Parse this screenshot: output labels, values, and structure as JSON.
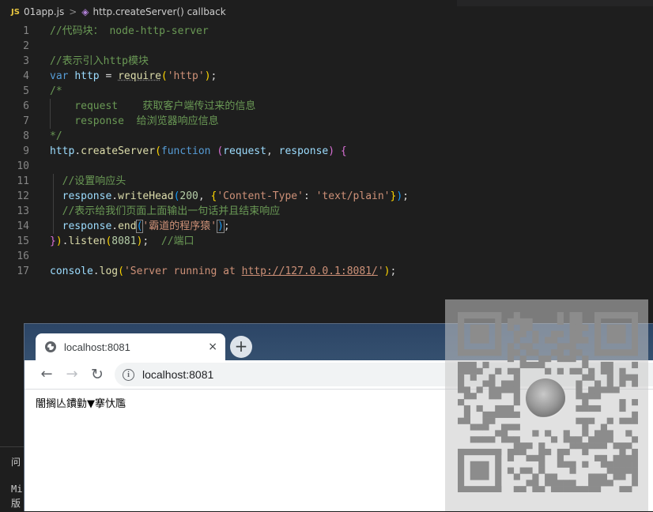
{
  "breadcrumb": {
    "file_badge": "JS",
    "file_name": "01app.js",
    "separator": ">",
    "symbol": "http.createServer() callback"
  },
  "editor": {
    "lines": [
      {
        "n": "1",
        "tokens": [
          {
            "t": "//代码块： node-http-server",
            "c": "c-comment"
          }
        ]
      },
      {
        "n": "2",
        "tokens": []
      },
      {
        "n": "3",
        "tokens": [
          {
            "t": "//表示引入http模块",
            "c": "c-comment"
          }
        ]
      },
      {
        "n": "4",
        "tokens": [
          {
            "t": "var",
            "c": "c-kw"
          },
          {
            "t": " "
          },
          {
            "t": "http",
            "c": "c-var"
          },
          {
            "t": " = "
          },
          {
            "t": "require",
            "c": "c-fn c-under"
          },
          {
            "t": "(",
            "c": "c-br1"
          },
          {
            "t": "'http'",
            "c": "c-str"
          },
          {
            "t": ")",
            "c": "c-br1"
          },
          {
            "t": ";"
          }
        ]
      },
      {
        "n": "5",
        "tokens": [
          {
            "t": "/*",
            "c": "c-comment"
          }
        ]
      },
      {
        "n": "6",
        "tokens": [
          {
            "t": "    request    获取客户端传过来的信息",
            "c": "c-comment"
          }
        ]
      },
      {
        "n": "7",
        "tokens": [
          {
            "t": "    response  给浏览器响应信息",
            "c": "c-comment"
          }
        ]
      },
      {
        "n": "8",
        "tokens": [
          {
            "t": "*/",
            "c": "c-comment"
          }
        ]
      },
      {
        "n": "9",
        "tokens": [
          {
            "t": "http",
            "c": "c-var"
          },
          {
            "t": "."
          },
          {
            "t": "createServer",
            "c": "c-fn"
          },
          {
            "t": "(",
            "c": "c-br1"
          },
          {
            "t": "function",
            "c": "c-kw"
          },
          {
            "t": " "
          },
          {
            "t": "(",
            "c": "c-br2"
          },
          {
            "t": "request",
            "c": "c-var"
          },
          {
            "t": ", "
          },
          {
            "t": "response",
            "c": "c-var"
          },
          {
            "t": ")",
            "c": "c-br2"
          },
          {
            "t": " "
          },
          {
            "t": "{",
            "c": "c-br2"
          }
        ]
      },
      {
        "n": "10",
        "tokens": []
      },
      {
        "n": "11",
        "tokens": [
          {
            "t": "  //设置响应头",
            "c": "c-comment"
          }
        ]
      },
      {
        "n": "12",
        "tokens": [
          {
            "t": "  "
          },
          {
            "t": "response",
            "c": "c-var"
          },
          {
            "t": "."
          },
          {
            "t": "writeHead",
            "c": "c-fn"
          },
          {
            "t": "(",
            "c": "c-br3"
          },
          {
            "t": "200",
            "c": "c-num"
          },
          {
            "t": ", "
          },
          {
            "t": "{",
            "c": "c-br1"
          },
          {
            "t": "'Content-Type'",
            "c": "c-str"
          },
          {
            "t": ": "
          },
          {
            "t": "'text/plain'",
            "c": "c-str"
          },
          {
            "t": "}",
            "c": "c-br1"
          },
          {
            "t": ")",
            "c": "c-br3"
          },
          {
            "t": ";"
          }
        ]
      },
      {
        "n": "13",
        "tokens": [
          {
            "t": "  //表示给我们页面上面输出一句话并且结束响应",
            "c": "c-comment"
          }
        ]
      },
      {
        "n": "14",
        "tokens": [
          {
            "t": "  "
          },
          {
            "t": "response",
            "c": "c-var"
          },
          {
            "t": "."
          },
          {
            "t": "end",
            "c": "c-fn"
          },
          {
            "t": "(",
            "c": "c-br3 hl-box"
          },
          {
            "t": "'霸道的程序猿'",
            "c": "c-str"
          },
          {
            "t": ")",
            "c": "c-br3 hl-box"
          },
          {
            "t": ";"
          }
        ]
      },
      {
        "n": "15",
        "tokens": [
          {
            "t": "}",
            "c": "c-br2"
          },
          {
            "t": ")",
            "c": "c-br1"
          },
          {
            "t": "."
          },
          {
            "t": "listen",
            "c": "c-fn"
          },
          {
            "t": "(",
            "c": "c-br1"
          },
          {
            "t": "8081",
            "c": "c-num"
          },
          {
            "t": ")",
            "c": "c-br1"
          },
          {
            "t": ";  "
          },
          {
            "t": "//端口",
            "c": "c-comment"
          }
        ]
      },
      {
        "n": "16",
        "tokens": []
      },
      {
        "n": "17",
        "tokens": [
          {
            "t": "console",
            "c": "c-var"
          },
          {
            "t": "."
          },
          {
            "t": "log",
            "c": "c-fn"
          },
          {
            "t": "(",
            "c": "c-br1"
          },
          {
            "t": "'Server running at ",
            "c": "c-str"
          },
          {
            "t": "http://127.0.0.1:8081/",
            "c": "c-str c-link"
          },
          {
            "t": "'",
            "c": "c-str"
          },
          {
            "t": ")",
            "c": "c-br1"
          },
          {
            "t": ";"
          }
        ]
      }
    ]
  },
  "panel": {
    "tab_fragment": "问",
    "line_a": "Mi",
    "line_b": "版"
  },
  "browser": {
    "tab_title": "localhost:8081",
    "tab_close": "×",
    "new_tab": "+",
    "back": "←",
    "forward": "→",
    "reload": "↻",
    "info": "i",
    "url": "localhost:8081",
    "page_text": "闇搁亾鐨勭▼搴忕尶"
  },
  "icons": {
    "globe": "globe-icon",
    "qr": "qr-code-watermark"
  }
}
